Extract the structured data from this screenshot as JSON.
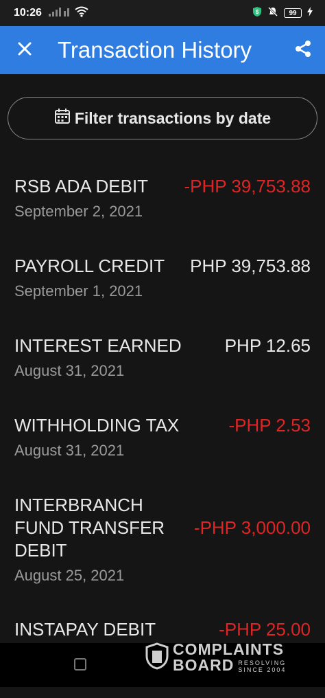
{
  "status_bar": {
    "time": "10:26",
    "battery": "99"
  },
  "app_bar": {
    "title": "Transaction History"
  },
  "filter": {
    "label": "Filter transactions by date"
  },
  "transactions": [
    {
      "name": "RSB ADA DEBIT",
      "date": "September 2, 2021",
      "amount": "-PHP 39,753.88",
      "type": "debit"
    },
    {
      "name": "PAYROLL CREDIT",
      "date": "September 1, 2021",
      "amount": "PHP 39,753.88",
      "type": "credit"
    },
    {
      "name": "INTEREST EARNED",
      "date": "August 31, 2021",
      "amount": "PHP 12.65",
      "type": "credit"
    },
    {
      "name": "WITHHOLDING TAX",
      "date": "August 31, 2021",
      "amount": "-PHP 2.53",
      "type": "debit"
    },
    {
      "name": "INTERBRANCH FUND TRANSFER DEBIT",
      "date": "August 25, 2021",
      "amount": "-PHP 3,000.00",
      "type": "debit"
    },
    {
      "name": "INSTAPAY DEBIT",
      "date": "",
      "amount": "-PHP 25.00",
      "type": "debit"
    }
  ],
  "watermark": {
    "line1": "COMPLAINTS",
    "line2": "BOARD",
    "tag1": "RESOLVING",
    "tag2": "SINCE 2004"
  },
  "colors": {
    "app_bar": "#2f7de1",
    "debit": "#e02424",
    "credit": "#e8e8e8",
    "background": "#151515"
  },
  "icons": [
    "close-icon",
    "share-icon",
    "calendar-icon",
    "wifi-icon",
    "signal-icon",
    "battery-icon",
    "shield-icon",
    "mute-icon"
  ]
}
